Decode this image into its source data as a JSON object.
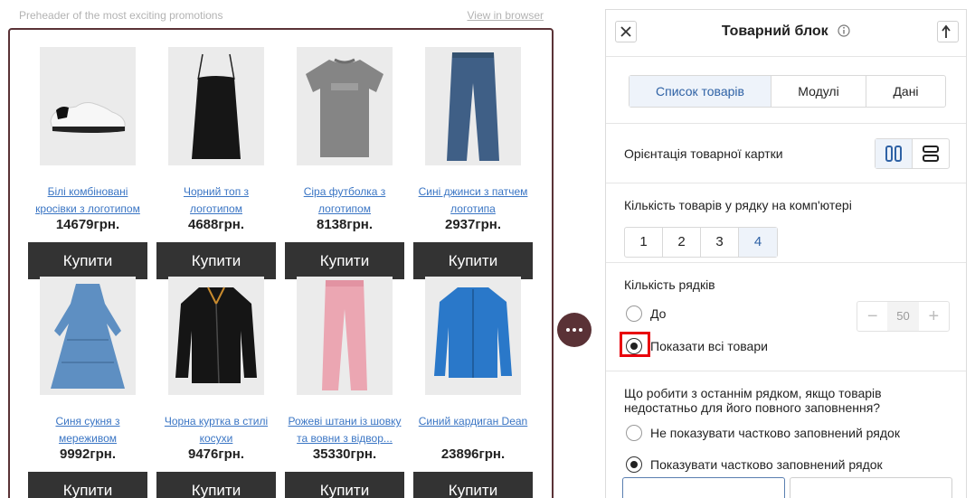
{
  "email": {
    "preheader": "Preheader of the most exciting promotions",
    "view_in_browser": "View in browser",
    "products": [
      {
        "name": "Білі комбіновані кросівки з логотипом",
        "price": "14679грн.",
        "buy": "Купити",
        "image": "sneaker-image"
      },
      {
        "name": "Чорний топ з логотипом",
        "price": "4688грн.",
        "buy": "Купити",
        "image": "tank-top-image"
      },
      {
        "name": "Сіра футболка з логотипом",
        "price": "8138грн.",
        "buy": "Купити",
        "image": "t-shirt-image"
      },
      {
        "name": "Сині джинси з патчем логотипа",
        "price": "2937грн.",
        "buy": "Купити",
        "image": "jeans-image"
      },
      {
        "name": "Синя сукня з мереживом",
        "price": "9992грн.",
        "buy": "Купити",
        "image": "dress-image"
      },
      {
        "name": "Чорна куртка в стилі косухи",
        "price": "9476грн.",
        "buy": "Купити",
        "image": "jacket-image"
      },
      {
        "name": "Рожеві штани із шовку та вовни з відвор...",
        "price": "35330грн.",
        "buy": "Купити",
        "image": "pants-image"
      },
      {
        "name": "Синий кардиган Dean",
        "price": "23896грн.",
        "buy": "Купити",
        "image": "cardigan-image"
      }
    ]
  },
  "panel": {
    "title": "Товарний блок",
    "tabs": [
      {
        "label": "Список товарів",
        "active": true
      },
      {
        "label": "Модулі",
        "active": false
      },
      {
        "label": "Дані",
        "active": false
      }
    ],
    "orientation_label": "Орієнтація товарної картки",
    "orientation_selected": "vertical-cards",
    "per_row_label": "Кількість товарів у рядку на комп'ютері",
    "per_row_options": [
      "1",
      "2",
      "3",
      "4"
    ],
    "per_row_selected": "4",
    "rows_label": "Кількість рядків",
    "rows_option_limit": "До",
    "rows_limit_value": "50",
    "rows_option_all": "Показати всі товари",
    "rows_selected": "all",
    "last_row_question": "Що робити з останнім рядком, якщо товарів недостатньо для його повного заповнення?",
    "last_row_hide": "Не показувати частково заповнений рядок",
    "last_row_show": "Показувати частково заповнений рядок",
    "last_row_selected": "show"
  },
  "colors": {
    "frame_accent": "#5a3236",
    "buy_button": "#333333",
    "link": "#3a75c4",
    "selected_bg": "#eef3fa",
    "highlight": "#e8000b"
  }
}
